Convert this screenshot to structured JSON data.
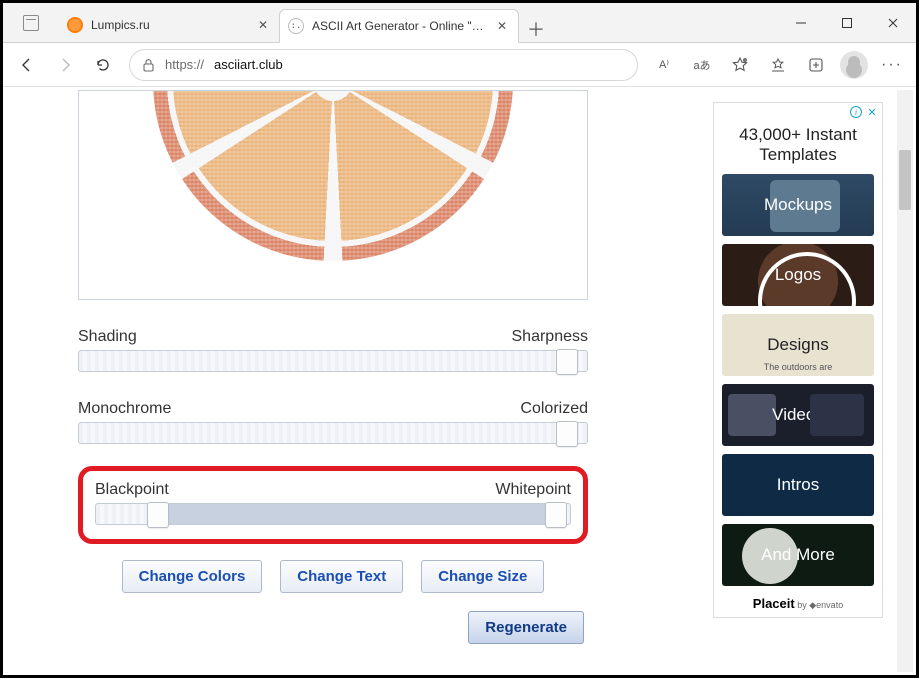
{
  "window": {
    "tabs": [
      {
        "title": "Lumpics.ru"
      },
      {
        "title": "ASCII Art Generator - Online \"HD"
      }
    ]
  },
  "toolbar": {
    "url_proto": "https://",
    "url_domain": "asciiart.club",
    "reader_badge": "A⁾",
    "translate_badge": "aあ"
  },
  "sliders": {
    "s1": {
      "left": "Shading",
      "right": "Sharpness",
      "thumb_pct": 96,
      "fill_pct": 0
    },
    "s2": {
      "left": "Monochrome",
      "right": "Colorized",
      "thumb_pct": 96,
      "fill_pct": 0
    },
    "s3": {
      "left": "Blackpoint",
      "right": "Whitepoint",
      "thumb_pct": 13,
      "fill_pct": 100
    }
  },
  "buttons": {
    "colors": "Change Colors",
    "text": "Change Text",
    "size": "Change Size",
    "regenerate": "Regenerate"
  },
  "ad": {
    "headline": "43,000+ Instant Templates",
    "cards": [
      "Mockups",
      "Logos",
      "Designs",
      "Videos",
      "Intros",
      "And More"
    ],
    "designs_sub": "The outdoors are",
    "footer_brand": "Placeit",
    "footer_by": "by",
    "footer_vendor": "envato"
  }
}
